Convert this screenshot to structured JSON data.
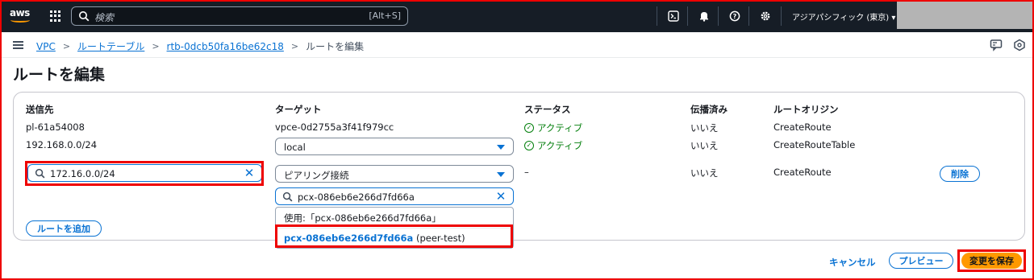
{
  "topnav": {
    "logo_text": "aws",
    "search_placeholder": "検索",
    "search_shortcut": "[Alt+S]",
    "region": "アジアパシフィック (東京) ▾",
    "icons": [
      "cloudshell-icon",
      "bell-icon",
      "help-icon",
      "settings-icon"
    ]
  },
  "breadcrumb": {
    "items": [
      "VPC",
      "ルートテーブル",
      "rtb-0dcb50fa16be62c18"
    ],
    "separator": ">",
    "current": "ルートを編集"
  },
  "page": {
    "title": "ルートを編集"
  },
  "routes": {
    "headers": {
      "destination": "送信先",
      "target": "ターゲット",
      "status": "ステータス",
      "propagated": "伝播済み",
      "origin": "ルートオリジン"
    },
    "rows": [
      {
        "destination": "pl-61a54008",
        "target": "vpce-0d2755a3f41f979cc",
        "status": "アクティブ",
        "propagated": "いいえ",
        "origin": "CreateRoute"
      },
      {
        "destination": "192.168.0.0/24",
        "target": "local",
        "status": "アクティブ",
        "propagated": "いいえ",
        "origin": "CreateRouteTable"
      },
      {
        "destination": "172.16.0.0/24",
        "target": "ピアリング接続",
        "target_search": "pcx-086eb6e266d7fd66a",
        "status": "–",
        "propagated": "いいえ",
        "origin": "CreateRoute",
        "remove_label": "削除"
      }
    ],
    "add_route_label": "ルートを追加"
  },
  "dropdown": {
    "use_option": "使用:「pcx-086eb6e266d7fd66a」",
    "option_id": "pcx-086eb6e266d7fd66a",
    "option_name": "(peer-test)"
  },
  "footer": {
    "cancel_label": "キャンセル",
    "preview_label": "プレビュー",
    "save_label": "変更を保存"
  },
  "colors": {
    "nav_bg": "#161d26",
    "link": "#0972d3",
    "success": "#037f0c",
    "primary": "#ff9900",
    "highlight": "#ee0000"
  }
}
